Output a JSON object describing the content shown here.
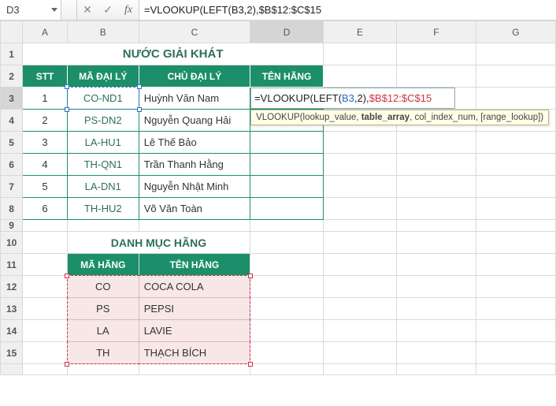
{
  "namebox": "D3",
  "formula_bar": "=VLOOKUP(LEFT(B3,2),$B$12:$C$15",
  "columns": [
    "A",
    "B",
    "C",
    "D",
    "E",
    "F",
    "G"
  ],
  "rows_visible": [
    1,
    2,
    3,
    4,
    5,
    6,
    7,
    8,
    9,
    10,
    11,
    12,
    13,
    14,
    15
  ],
  "title1": "NƯỚC GIẢI KHÁT",
  "headers1": {
    "stt": "STT",
    "ma": "MÃ ĐẠI LÝ",
    "chu": "CHỦ ĐẠI LÝ",
    "ten": "TÊN HÃNG"
  },
  "table1": [
    {
      "stt": "1",
      "ma": "CO-ND1",
      "chu": "Huỳnh Văn Nam"
    },
    {
      "stt": "2",
      "ma": "PS-DN2",
      "chu": "Nguyễn Quang Hải"
    },
    {
      "stt": "3",
      "ma": "LA-HU1",
      "chu": "Lê Thế Bảo"
    },
    {
      "stt": "4",
      "ma": "TH-QN1",
      "chu": "Trần Thanh Hằng"
    },
    {
      "stt": "5",
      "ma": "LA-DN1",
      "chu": "Nguyễn Nhật Minh"
    },
    {
      "stt": "6",
      "ma": "TH-HU2",
      "chu": "Võ Văn Toàn"
    }
  ],
  "title2": "DANH MỤC HÃNG",
  "headers2": {
    "ma": "MÃ HÃNG",
    "ten": "TÊN HÃNG"
  },
  "table2": [
    {
      "ma": "CO",
      "ten": "COCA COLA"
    },
    {
      "ma": "PS",
      "ten": "PEPSI"
    },
    {
      "ma": "LA",
      "ten": "LAVIE"
    },
    {
      "ma": "TH",
      "ten": "THẠCH BÍCH"
    }
  ],
  "active_formula": {
    "prefix1": "=VLOOKUP(LEFT(",
    "ref1": "B3",
    "mid1": ",2),",
    "ref2": "$B$12:$C$15",
    "suffix": ""
  },
  "tooltip": {
    "fn": "VLOOKUP(",
    "p1": "lookup_value",
    "sep1": ", ",
    "p2": "table_array",
    "sep2": ", col_index_num, [range_lookup])"
  },
  "icons": {
    "cancel": "✕",
    "enter": "✓",
    "fx": "fx",
    "dropdown": "▼"
  }
}
